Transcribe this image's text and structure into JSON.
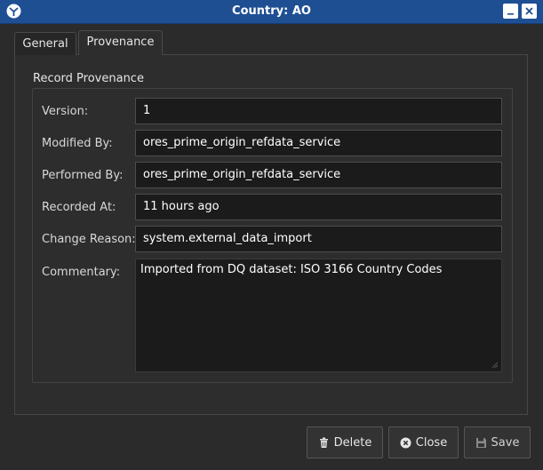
{
  "window": {
    "title": "Country: AO"
  },
  "tabs": [
    {
      "label": "General",
      "selected": false
    },
    {
      "label": "Provenance",
      "selected": true
    }
  ],
  "group": {
    "title": "Record Provenance"
  },
  "fields": {
    "version": {
      "label": "Version:",
      "value": "1"
    },
    "modified_by": {
      "label": "Modified By:",
      "value": "ores_prime_origin_refdata_service"
    },
    "performed_by": {
      "label": "Performed By:",
      "value": "ores_prime_origin_refdata_service"
    },
    "recorded_at": {
      "label": "Recorded At:",
      "value": "11 hours ago"
    },
    "change_reason": {
      "label": "Change Reason:",
      "value": "system.external_data_import"
    },
    "commentary": {
      "label": "Commentary:",
      "value": "Imported from DQ dataset: ISO 3166 Country Codes"
    }
  },
  "buttons": {
    "delete": {
      "label": "Delete",
      "icon": "trash-icon"
    },
    "close": {
      "label": "Close",
      "icon": "close-circle-icon"
    },
    "save": {
      "label": "Save",
      "icon": "floppy-icon"
    }
  },
  "colors": {
    "titlebar": "#1f4f93",
    "background": "#2b2b2b",
    "field_background": "#1b1b1b"
  }
}
